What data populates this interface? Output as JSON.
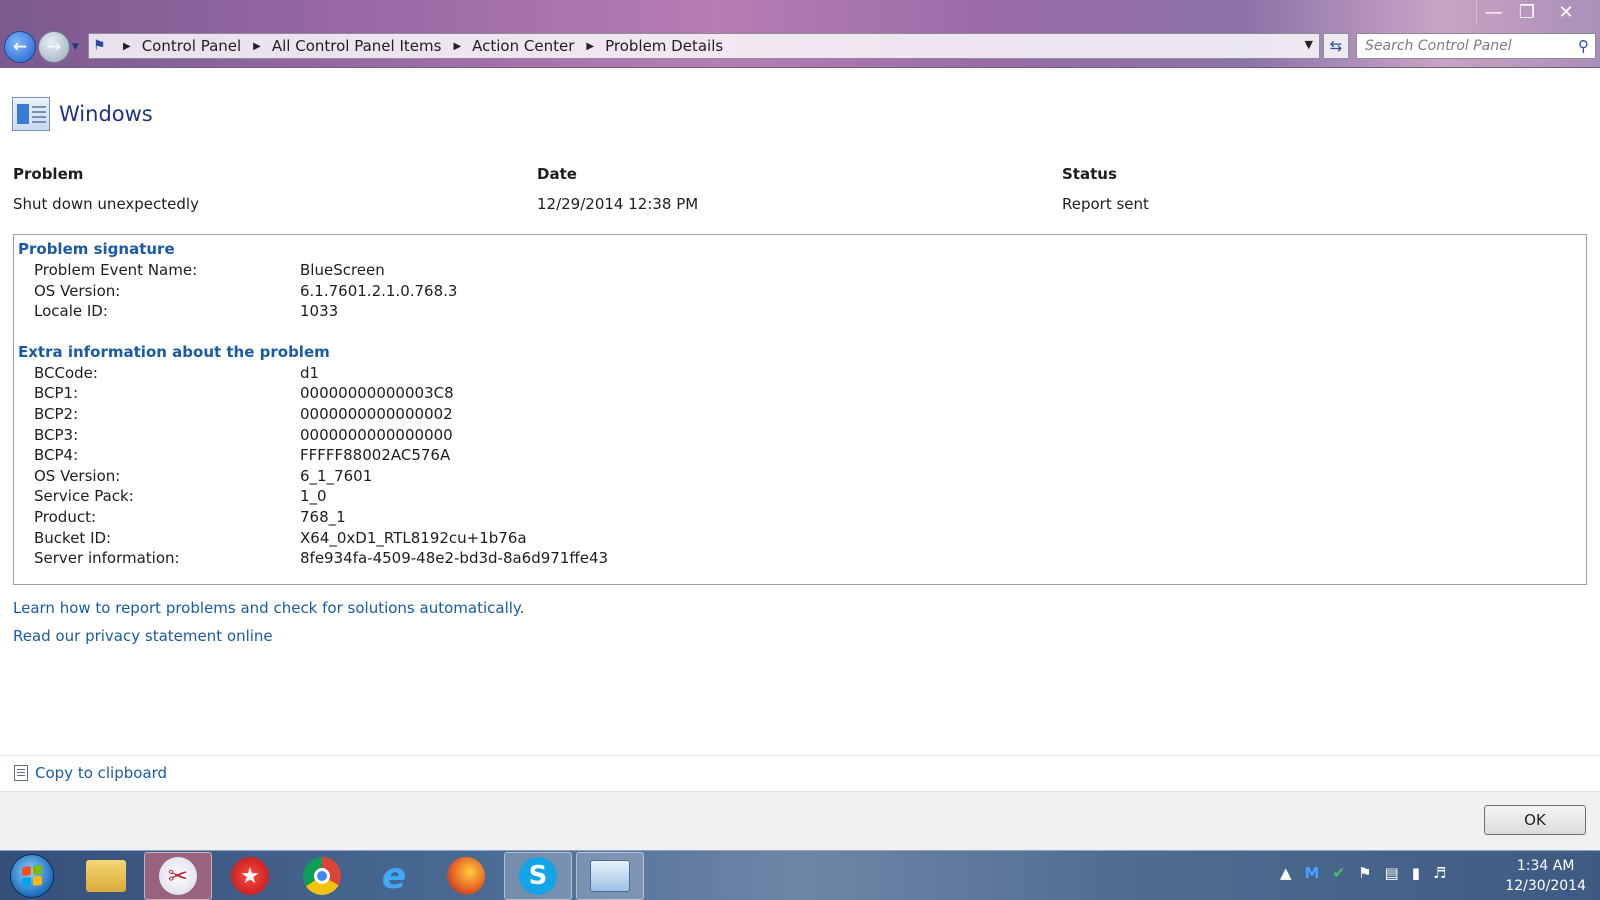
{
  "window": {
    "address": {
      "crumbs": [
        "Control Panel",
        "All Control Panel Items",
        "Action Center",
        "Problem Details"
      ]
    },
    "search_placeholder": "Search Control Panel"
  },
  "header": {
    "title": "Windows"
  },
  "summary": {
    "problem_label": "Problem",
    "problem_value": "Shut down unexpectedly",
    "date_label": "Date",
    "date_value": "12/29/2014 12:38 PM",
    "status_label": "Status",
    "status_value": "Report sent"
  },
  "signature": {
    "title": "Problem signature",
    "rows": [
      {
        "k": "Problem Event Name:",
        "v": "BlueScreen"
      },
      {
        "k": "OS Version:",
        "v": "6.1.7601.2.1.0.768.3"
      },
      {
        "k": "Locale ID:",
        "v": "1033"
      }
    ]
  },
  "extra": {
    "title": "Extra information about the problem",
    "rows": [
      {
        "k": "BCCode:",
        "v": "d1"
      },
      {
        "k": "BCP1:",
        "v": "00000000000003C8"
      },
      {
        "k": "BCP2:",
        "v": "0000000000000002"
      },
      {
        "k": "BCP3:",
        "v": "0000000000000000"
      },
      {
        "k": "BCP4:",
        "v": "FFFFF88002AC576A"
      },
      {
        "k": "OS Version:",
        "v": "6_1_7601"
      },
      {
        "k": "Service Pack:",
        "v": "1_0"
      },
      {
        "k": "Product:",
        "v": "768_1"
      },
      {
        "k": "Bucket ID:",
        "v": "X64_0xD1_RTL8192cu+1b76a"
      },
      {
        "k": "Server information:",
        "v": "8fe934fa-4509-48e2-bd3d-8a6d971ffe43"
      }
    ]
  },
  "links": {
    "learn": "Learn how to report problems and check for solutions automatically.",
    "privacy": "Read our privacy statement online"
  },
  "copy_label": "Copy to clipboard",
  "ok_label": "OK",
  "taskbar": {
    "items": [
      "folder-icon",
      "snipping-tool-icon",
      "pokerstars-icon",
      "chrome-icon",
      "internet-explorer-icon",
      "firefox-icon",
      "skype-icon",
      "control-panel-icon"
    ],
    "time": "1:34 AM",
    "date": "12/30/2014"
  },
  "colors": {
    "link": "#1a5aa6",
    "title": "#1e3287"
  }
}
